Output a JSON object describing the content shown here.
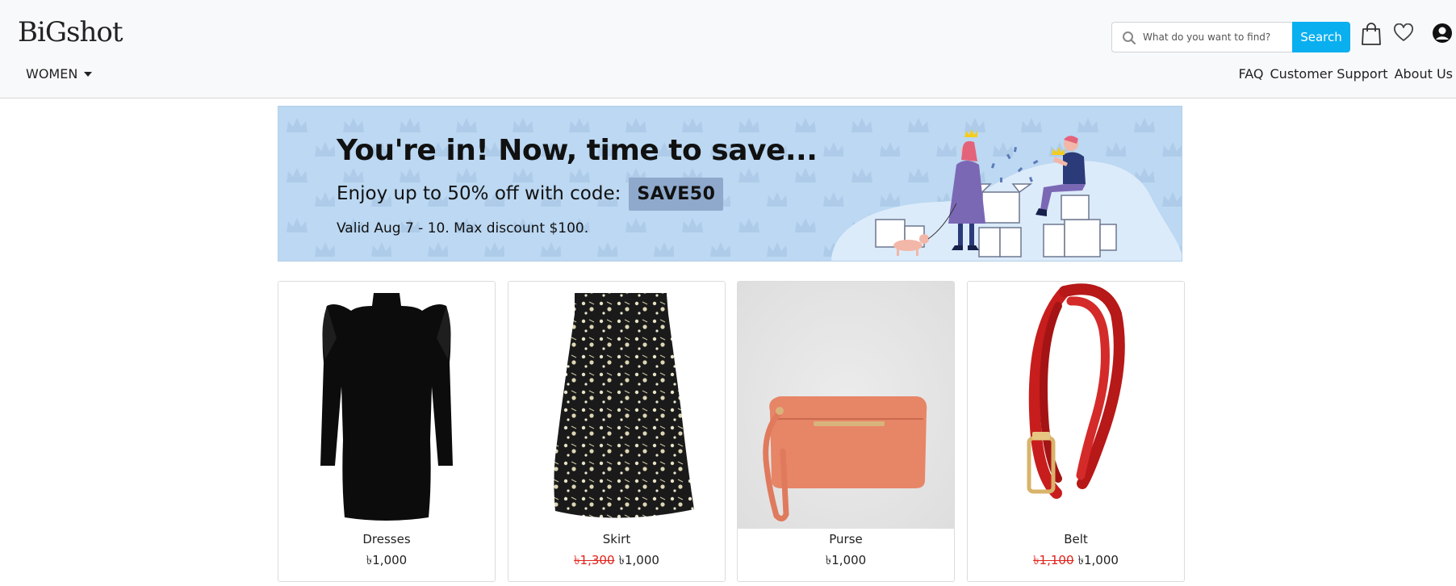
{
  "brand": {
    "logo_text": "BiGshot"
  },
  "search": {
    "placeholder": "What do you want to find?",
    "button_label": "Search"
  },
  "header_icons": [
    "search-icon",
    "shopping-bag-icon",
    "heart-icon",
    "user-account-icon"
  ],
  "nav": {
    "category_label": "WOMEN",
    "links": [
      "FAQ",
      "Customer Support",
      "About Us"
    ]
  },
  "banner": {
    "title": "You're in! Now, time to save...",
    "offer_text": "Enjoy up to 50% off with code:",
    "code": "SAVE50",
    "valid_text": "Valid Aug 7 - 10. Max discount $100."
  },
  "products": [
    {
      "name": "Dresses",
      "old_price": "",
      "price": "৳1,000",
      "image": "black-dress-image"
    },
    {
      "name": "Skirt",
      "old_price": "৳1,300",
      "price": "৳1,000",
      "image": "floral-skirt-image"
    },
    {
      "name": "Purse",
      "old_price": "",
      "price": "৳1,000",
      "image": "coral-purse-image"
    },
    {
      "name": "Belt",
      "old_price": "৳1,100",
      "price": "৳1,000",
      "image": "red-belt-image"
    }
  ],
  "colors": {
    "search_button": "#0aaff0",
    "banner_bg": "#bcd8f2",
    "code_bg": "#8ea9cc",
    "old_price": "#e0241b"
  }
}
